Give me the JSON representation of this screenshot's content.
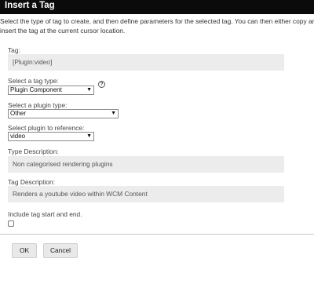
{
  "dialog": {
    "title": "Insert a Tag",
    "intro_line1": "Select the type of tag to create, and then define parameters for the selected tag. You can then either copy and pas",
    "intro_line2": "insert the tag at the current cursor location."
  },
  "tag": {
    "label": "Tag:",
    "value": "[Plugin:video]"
  },
  "tag_type": {
    "label": "Select a tag type:",
    "selected": "Plugin Component",
    "help": "?"
  },
  "plugin_type": {
    "label": "Select a plugin type:",
    "selected": "Other"
  },
  "plugin_reference": {
    "label": "Select plugin to reference:",
    "selected": "video"
  },
  "type_description": {
    "label": "Type Description:",
    "value": "Non categorised rendering plugins"
  },
  "tag_description": {
    "label": "Tag Description:",
    "value": "Renders a youtube video within WCM Content"
  },
  "include_tags": {
    "label": "Include tag start and end.",
    "checked": false
  },
  "buttons": {
    "ok": "OK",
    "cancel": "Cancel"
  }
}
